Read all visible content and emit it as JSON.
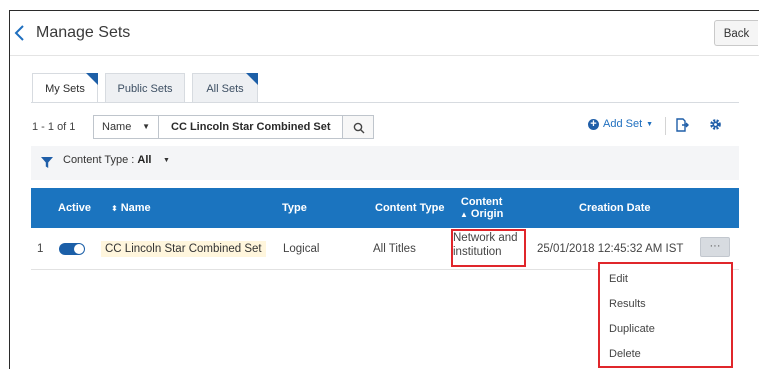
{
  "header": {
    "title": "Manage Sets",
    "back_label": "Back"
  },
  "tabs": [
    {
      "label": "My Sets",
      "active": true
    },
    {
      "label": "Public Sets",
      "active": false
    },
    {
      "label": "All Sets",
      "active": false
    }
  ],
  "toolbar": {
    "count": "1 - 1 of 1",
    "field": "Name",
    "search_value": "CC Lincoln Star Combined Set",
    "add_set_label": "Add Set"
  },
  "filter": {
    "label": "Content Type :",
    "value": "All"
  },
  "table": {
    "columns": {
      "active": "Active",
      "name": "Name",
      "type": "Type",
      "content_type": "Content Type",
      "content_origin_1": "Content",
      "content_origin_2": "Origin",
      "creation_date": "Creation Date"
    },
    "rows": [
      {
        "index": "1",
        "active": true,
        "name": "CC Lincoln Star Combined Set",
        "type": "Logical",
        "content_type": "All Titles",
        "content_origin_1": "Network and",
        "content_origin_2": "institution",
        "creation_date": "25/01/2018 12:45:32 AM IST",
        "more_label": "···"
      }
    ]
  },
  "row_menu": {
    "items": [
      "Edit",
      "Results",
      "Duplicate",
      "Delete"
    ]
  },
  "colors": {
    "accent": "#1b74bf",
    "highlight_border": "#e0262b",
    "name_highlight": "#fff6dd"
  }
}
